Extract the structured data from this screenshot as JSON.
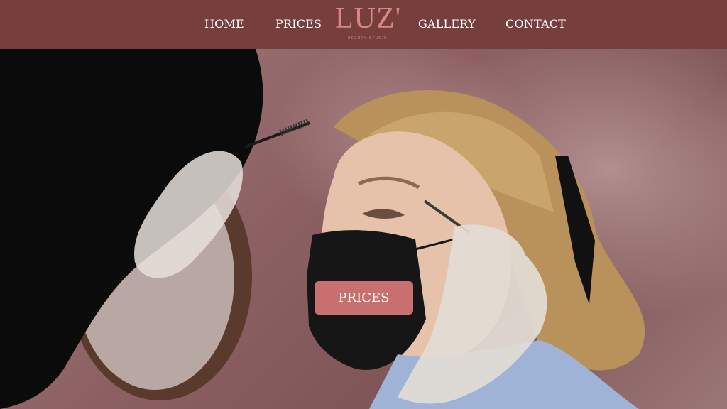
{
  "nav": {
    "items": [
      {
        "label": "HOME"
      },
      {
        "label": "PRICES"
      },
      {
        "label": "GALLERY"
      },
      {
        "label": "CONTACT"
      }
    ],
    "logo": {
      "text": "LUZ'",
      "subtext": "BEAUTY STUDIO"
    }
  },
  "hero": {
    "cta_label": "PRICES",
    "image_description_icon": "hero-photo"
  },
  "colors": {
    "navbar": "#773f3c",
    "logo": "#d98688",
    "cta": "#c86f70",
    "nav_text": "#ffffff"
  }
}
